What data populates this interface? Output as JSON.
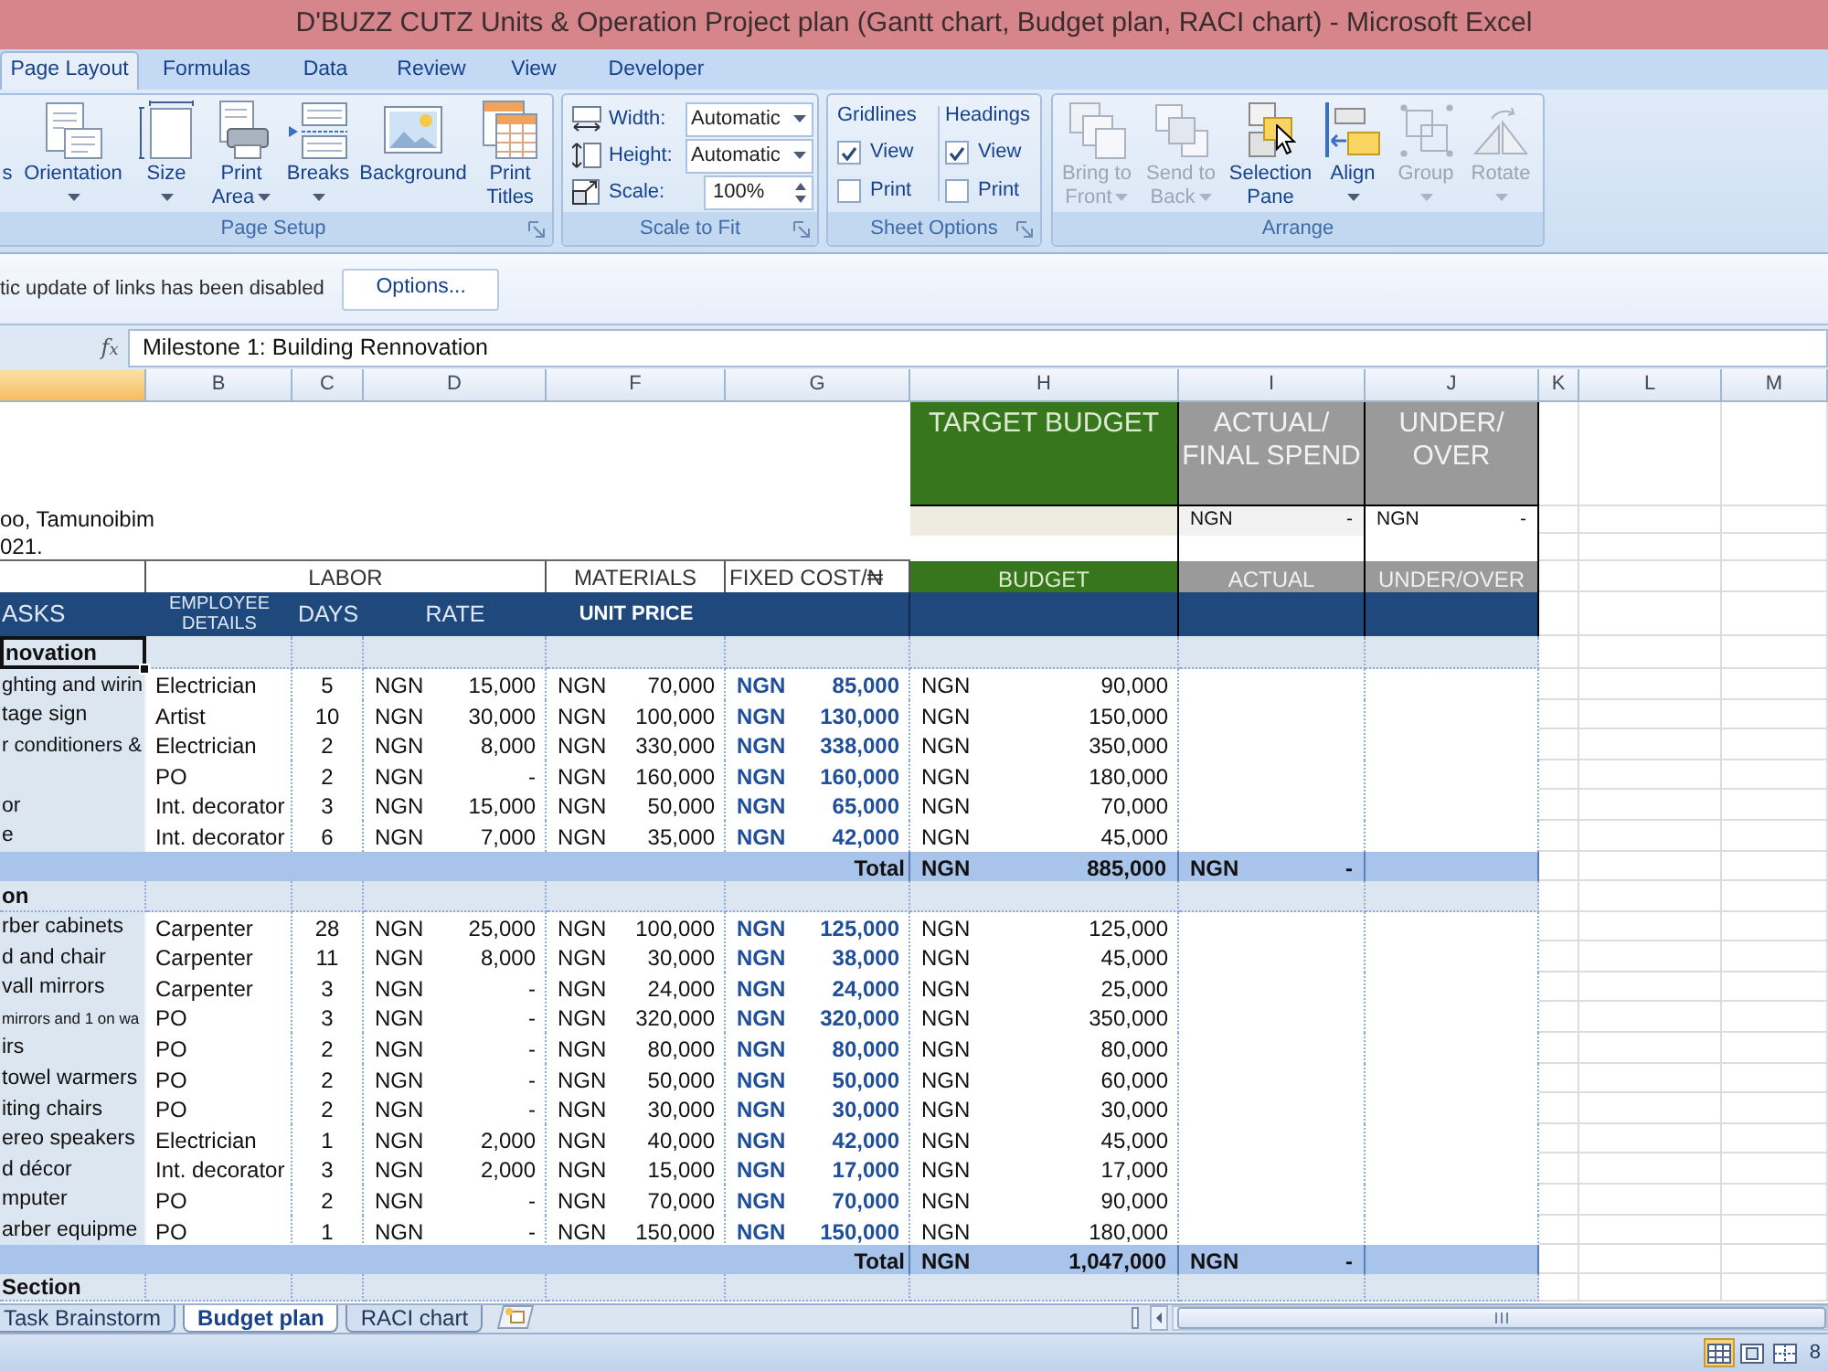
{
  "window": {
    "title": "D'BUZZ CUTZ Units & Operation Project plan (Gantt chart, Budget plan, RACI chart) - Microsoft Excel"
  },
  "ribbon_tabs": [
    {
      "label": "Page Layout",
      "selected": true
    },
    {
      "label": "Formulas",
      "selected": false
    },
    {
      "label": "Data",
      "selected": false
    },
    {
      "label": "Review",
      "selected": false
    },
    {
      "label": "View",
      "selected": false
    },
    {
      "label": "Developer",
      "selected": false
    }
  ],
  "ribbon": {
    "page_setup": {
      "label": "Page Setup",
      "buttons": [
        {
          "label": "s",
          "dropdown": false
        },
        {
          "label": "Orientation",
          "dropdown": true
        },
        {
          "label": "Size",
          "dropdown": true
        },
        {
          "label": "Print\nArea",
          "dropdown": true
        },
        {
          "label": "Breaks",
          "dropdown": true
        },
        {
          "label": "Background",
          "dropdown": false
        },
        {
          "label": "Print\nTitles",
          "dropdown": false
        }
      ]
    },
    "scale_to_fit": {
      "label": "Scale to Fit",
      "fields": [
        {
          "label": "Width:",
          "value": "Automatic",
          "kind": "dropdown"
        },
        {
          "label": "Height:",
          "value": "Automatic",
          "kind": "dropdown"
        },
        {
          "label": "Scale:",
          "value": "100%",
          "kind": "spinner"
        }
      ]
    },
    "sheet_options": {
      "label": "Sheet Options",
      "columns": [
        {
          "title": "Gridlines",
          "options": [
            {
              "label": "View",
              "checked": true
            },
            {
              "label": "Print",
              "checked": false
            }
          ]
        },
        {
          "title": "Headings",
          "options": [
            {
              "label": "View",
              "checked": true
            },
            {
              "label": "Print",
              "checked": false
            }
          ]
        }
      ]
    },
    "arrange": {
      "label": "Arrange",
      "buttons": [
        {
          "label": "Bring to\nFront",
          "dropdown": true,
          "disabled": true
        },
        {
          "label": "Send to\nBack",
          "dropdown": true,
          "disabled": true
        },
        {
          "label": "Selection\nPane",
          "dropdown": false,
          "disabled": false
        },
        {
          "label": "Align",
          "dropdown": true,
          "disabled": false
        },
        {
          "label": "Group",
          "dropdown": true,
          "disabled": true
        },
        {
          "label": "Rotate",
          "dropdown": true,
          "disabled": true
        }
      ]
    }
  },
  "message_bar": {
    "text": "tic update of links has been disabled",
    "button": "Options..."
  },
  "formula_bar": {
    "function_label": "f$_{x}$",
    "formula": "Milestone 1: Building Rennovation"
  },
  "sheet": {
    "column_headers": [
      {
        "selected": true
      },
      {
        "label": "B",
        "selected": false
      },
      {
        "label": "C",
        "selected": false
      },
      {
        "label": "D",
        "selected": false
      },
      {
        "label": "F",
        "selected": false
      },
      {
        "label": "G",
        "selected": false
      },
      {
        "label": "H",
        "selected": false
      },
      {
        "label": "I",
        "selected": false
      },
      {
        "label": "J",
        "selected": false
      },
      {
        "label": "K",
        "selected": false
      },
      {
        "label": "L",
        "selected": false
      },
      {
        "label": "M",
        "selected": false
      }
    ],
    "header_notes": [
      "oo, Tamunoibim",
      "021."
    ],
    "target_budget": {
      "title": "TARGET BUDGET",
      "subtitle": "BUDGET"
    },
    "actual": {
      "title": "ACTUAL/\nFINAL SPEND",
      "value": [
        "NGN",
        "-"
      ],
      "subtitle": "ACTUAL"
    },
    "under_over": {
      "title": "UNDER/\nOVER",
      "value": [
        "NGN",
        "-"
      ],
      "subtitle": "UNDER/OVER"
    },
    "group_labels": {
      "labor": "LABOR",
      "materials": "MATERIALS",
      "fixed_cost": "FIXED COST/₦"
    },
    "table_headings": {
      "tasks": "ASKS",
      "employee": "EMPLOYEE\nDETAILS",
      "days": "DAYS",
      "rate": "RATE",
      "unit_price": "UNIT PRICE"
    },
    "sections": [
      {
        "title": "novation",
        "selected": true,
        "rows": [
          {
            "task": "ghting and wirin",
            "employee": "Electrician",
            "days": "5",
            "rate": [
              "NGN",
              "15,000"
            ],
            "unit_price": [
              "NGN",
              "70,000"
            ],
            "fixed_cost": [
              "NGN",
              "85,000"
            ],
            "budget": [
              "NGN",
              "90,000"
            ]
          },
          {
            "task": "tage sign",
            "employee": "Artist",
            "days": "10",
            "rate": [
              "NGN",
              "30,000"
            ],
            "unit_price": [
              "NGN",
              "100,000"
            ],
            "fixed_cost": [
              "NGN",
              "130,000"
            ],
            "budget": [
              "NGN",
              "150,000"
            ]
          },
          {
            "task": "r conditioners &",
            "employee": "Electrician",
            "days": "2",
            "rate": [
              "NGN",
              "8,000"
            ],
            "unit_price": [
              "NGN",
              "330,000"
            ],
            "fixed_cost": [
              "NGN",
              "338,000"
            ],
            "budget": [
              "NGN",
              "350,000"
            ]
          },
          {
            "employee": "PO",
            "days": "2",
            "rate": [
              "NGN",
              "-"
            ],
            "unit_price": [
              "NGN",
              "160,000"
            ],
            "fixed_cost": [
              "NGN",
              "160,000"
            ],
            "budget": [
              "NGN",
              "180,000"
            ]
          },
          {
            "task": "or",
            "employee": "Int. decorator",
            "days": "3",
            "rate": [
              "NGN",
              "15,000"
            ],
            "unit_price": [
              "NGN",
              "50,000"
            ],
            "fixed_cost": [
              "NGN",
              "65,000"
            ],
            "budget": [
              "NGN",
              "70,000"
            ]
          },
          {
            "task": "e",
            "employee": "Int. decorator",
            "days": "6",
            "rate": [
              "NGN",
              "7,000"
            ],
            "unit_price": [
              "NGN",
              "35,000"
            ],
            "fixed_cost": [
              "NGN",
              "42,000"
            ],
            "budget": [
              "NGN",
              "45,000"
            ]
          }
        ],
        "total": {
          "label": "Total",
          "budget": [
            "NGN",
            "885,000"
          ],
          "actual": [
            "NGN",
            "-"
          ]
        }
      },
      {
        "title": "on",
        "selected": false,
        "rows": [
          {
            "task": "rber cabinets",
            "employee": "Carpenter",
            "days": "28",
            "rate": [
              "NGN",
              "25,000"
            ],
            "unit_price": [
              "NGN",
              "100,000"
            ],
            "fixed_cost": [
              "NGN",
              "125,000"
            ],
            "budget": [
              "NGN",
              "125,000"
            ]
          },
          {
            "task": "d and chair",
            "employee": "Carpenter",
            "days": "11",
            "rate": [
              "NGN",
              "8,000"
            ],
            "unit_price": [
              "NGN",
              "30,000"
            ],
            "fixed_cost": [
              "NGN",
              "38,000"
            ],
            "budget": [
              "NGN",
              "45,000"
            ]
          },
          {
            "task": "vall mirrors",
            "employee": "Carpenter",
            "days": "3",
            "rate": [
              "NGN",
              "-"
            ],
            "unit_price": [
              "NGN",
              "24,000"
            ],
            "fixed_cost": [
              "NGN",
              "24,000"
            ],
            "budget": [
              "NGN",
              "25,000"
            ]
          },
          {
            "task": "mirrors and 1 on wa",
            "employee": "PO",
            "days": "3",
            "rate": [
              "NGN",
              "-"
            ],
            "unit_price": [
              "NGN",
              "320,000"
            ],
            "fixed_cost": [
              "NGN",
              "320,000"
            ],
            "budget": [
              "NGN",
              "350,000"
            ]
          },
          {
            "task": "irs",
            "employee": "PO",
            "days": "2",
            "rate": [
              "NGN",
              "-"
            ],
            "unit_price": [
              "NGN",
              "80,000"
            ],
            "fixed_cost": [
              "NGN",
              "80,000"
            ],
            "budget": [
              "NGN",
              "80,000"
            ]
          },
          {
            "task": "towel warmers",
            "employee": "PO",
            "days": "2",
            "rate": [
              "NGN",
              "-"
            ],
            "unit_price": [
              "NGN",
              "50,000"
            ],
            "fixed_cost": [
              "NGN",
              "50,000"
            ],
            "budget": [
              "NGN",
              "60,000"
            ]
          },
          {
            "task": "iting chairs",
            "employee": "PO",
            "days": "2",
            "rate": [
              "NGN",
              "-"
            ],
            "unit_price": [
              "NGN",
              "30,000"
            ],
            "fixed_cost": [
              "NGN",
              "30,000"
            ],
            "budget": [
              "NGN",
              "30,000"
            ]
          },
          {
            "task": "ereo speakers",
            "employee": "Electrician",
            "days": "1",
            "rate": [
              "NGN",
              "2,000"
            ],
            "unit_price": [
              "NGN",
              "40,000"
            ],
            "fixed_cost": [
              "NGN",
              "42,000"
            ],
            "budget": [
              "NGN",
              "45,000"
            ]
          },
          {
            "task": "d décor",
            "employee": "Int. decorator",
            "days": "3",
            "rate": [
              "NGN",
              "2,000"
            ],
            "unit_price": [
              "NGN",
              "15,000"
            ],
            "fixed_cost": [
              "NGN",
              "17,000"
            ],
            "budget": [
              "NGN",
              "17,000"
            ]
          },
          {
            "task": "mputer",
            "employee": "PO",
            "days": "2",
            "rate": [
              "NGN",
              "-"
            ],
            "unit_price": [
              "NGN",
              "70,000"
            ],
            "fixed_cost": [
              "NGN",
              "70,000"
            ],
            "budget": [
              "NGN",
              "90,000"
            ]
          },
          {
            "task": "arber equipme",
            "employee": "PO",
            "days": "1",
            "rate": [
              "NGN",
              "-"
            ],
            "unit_price": [
              "NGN",
              "150,000"
            ],
            "fixed_cost": [
              "NGN",
              "150,000"
            ],
            "budget": [
              "NGN",
              "180,000"
            ]
          }
        ],
        "total": {
          "label": "Total",
          "budget": [
            "NGN",
            "1,047,000"
          ],
          "actual": [
            "NGN",
            "-"
          ]
        }
      },
      {
        "title": "Section",
        "selected": false
      }
    ]
  },
  "sheet_tabs": [
    {
      "label": "Task Brainstorm",
      "selected": false
    },
    {
      "label": "Budget plan",
      "selected": true
    },
    {
      "label": "RACI chart",
      "selected": false
    }
  ],
  "status_bar": {
    "view_buttons": [
      {
        "selected": true
      },
      {
        "selected": false
      },
      {
        "selected": false
      }
    ],
    "text": "8"
  }
}
